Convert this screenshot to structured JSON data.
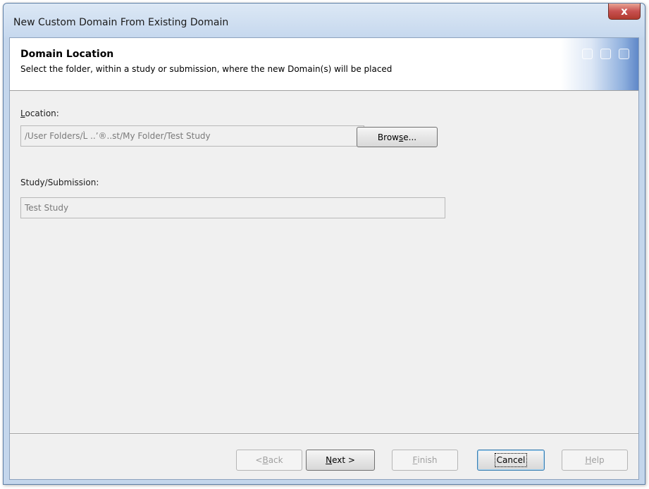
{
  "window": {
    "title": "New Custom Domain From Existing Domain",
    "close_glyph": "x"
  },
  "header": {
    "title": "Domain Location",
    "subtitle": "Select the folder, within a study or submission, where the new Domain(s) will be placed"
  },
  "location": {
    "label_access_key": "L",
    "label_rest": "ocation:",
    "value": "/User Folders/L̀ ..’®..st/My Folder/Test Study",
    "browse": {
      "pre": "Brow",
      "key": "s",
      "post": "e..."
    }
  },
  "study": {
    "label": "Study/Submission:",
    "value": "Test Study"
  },
  "buttons": {
    "back": {
      "pre": "< ",
      "key": "B",
      "post": "ack"
    },
    "next": {
      "pre": "",
      "key": "N",
      "post": "ext >"
    },
    "finish": {
      "pre": "",
      "key": "F",
      "post": "inish"
    },
    "cancel": {
      "label": "Cancel"
    },
    "help": {
      "pre": "",
      "key": "H",
      "post": "elp"
    }
  }
}
